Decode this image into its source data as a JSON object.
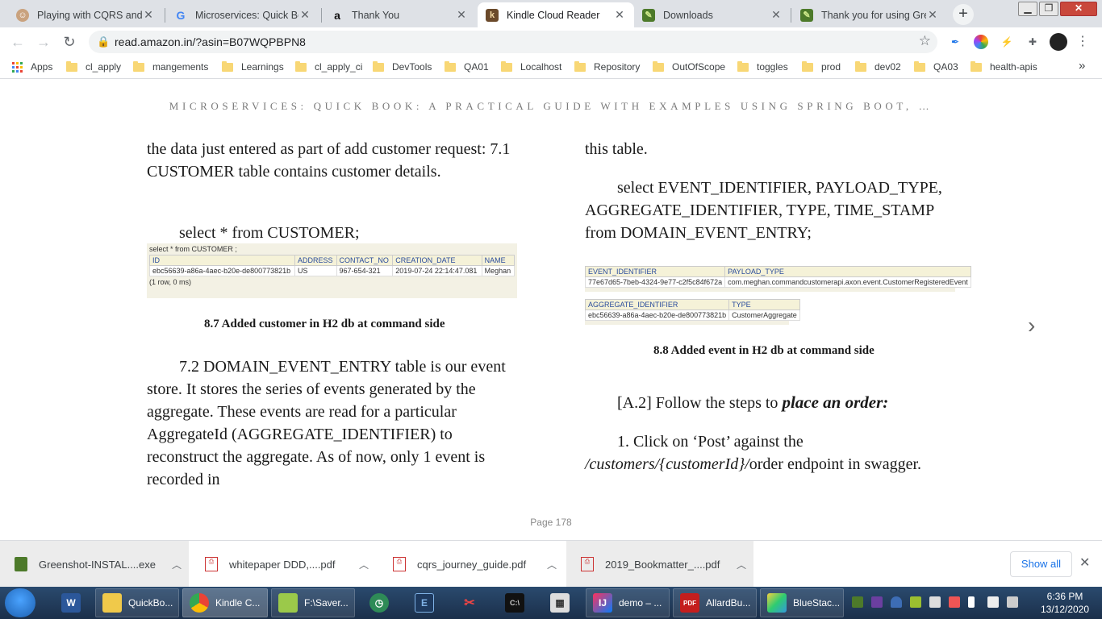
{
  "tabs": [
    {
      "title": "Playing with CQRS and E",
      "favicon": "avatar-icon"
    },
    {
      "title": "Microservices: Quick Boo",
      "favicon": "google-icon"
    },
    {
      "title": "Thank You",
      "favicon": "amazon-icon"
    },
    {
      "title": "Kindle Cloud Reader",
      "favicon": "kindle-icon",
      "active": true
    },
    {
      "title": "Downloads",
      "favicon": "greenshot-icon"
    },
    {
      "title": "Thank you for using Gree",
      "favicon": "greenshot-icon"
    }
  ],
  "toolbar": {
    "url": "read.amazon.in/?asin=B07WQPBPN8"
  },
  "bookmarks": {
    "apps_label": "Apps",
    "items": [
      "cl_apply",
      "mangements",
      "Learnings",
      "cl_apply_ci",
      "DevTools",
      "QA01",
      "Localhost",
      "Repository",
      "OutOfScope",
      "toggles",
      "prod",
      "dev02",
      "QA03",
      "health-apis"
    ],
    "overflow": "»"
  },
  "book": {
    "title": "MICROSERVICES: QUICK BOOK: A PRACTICAL GUIDE WITH EXAMPLES USING SPRING BOOT, …",
    "left": {
      "para1": "the data just entered as part of add customer request: 7.1 CUSTOMER table contains customer details.",
      "query": "select * from CUSTOMER;",
      "shot": {
        "header": "select * from CUSTOMER ;",
        "columns": [
          "ID",
          "ADDRESS",
          "CONTACT_NO",
          "CREATION_DATE",
          "NAME"
        ],
        "row": [
          "ebc56639-a86a-4aec-b20e-de800773821b",
          "US",
          "967-654-321",
          "2019-07-24 22:14:47.081",
          "Meghan"
        ],
        "footer": "(1 row, 0 ms)"
      },
      "caption": "8.7 Added customer in H2 db at command side",
      "para2": "7.2 DOMAIN_EVENT_ENTRY table is our event store. It stores the series of events generated by the aggregate. These events are read for a particular AggregateId (AGGREGATE_IDENTIFIER) to reconstruct the aggregate. As of now, only 1 event is recorded in"
    },
    "right": {
      "para1": "this table.",
      "query": "select EVENT_IDENTIFIER, PAYLOAD_TYPE, AGGREGATE_IDENTIFIER, TYPE,  TIME_STAMP  from DOMAIN_EVENT_ENTRY;",
      "shot1": {
        "columns": [
          "EVENT_IDENTIFIER",
          "PAYLOAD_TYPE"
        ],
        "row": [
          "77e67d65-7beb-4324-9e77-c2f5c84f672a",
          "com.meghan.commandcustomerapi.axon.event.CustomerRegisteredEvent"
        ]
      },
      "shot2": {
        "columns": [
          "AGGREGATE_IDENTIFIER",
          "TYPE"
        ],
        "row": [
          "ebc56639-a86a-4aec-b20e-de800773821b",
          "CustomerAggregate"
        ]
      },
      "caption": "8.8 Added event in H2 db at command side",
      "step_prefix": "[A.2] Follow the steps to ",
      "step_emph": "place an order:",
      "item_prefix": "1. Click on ‘Post’ against the ",
      "item_path": "/customers/{customerId}/",
      "item_suffix": "order endpoint in swagger."
    },
    "page": "Page 178"
  },
  "downloads": {
    "items": [
      "Greenshot-INSTAL....exe",
      "whitepaper DDD,....pdf",
      "cqrs_journey_guide.pdf",
      "2019_Bookmatter_....pdf"
    ],
    "show_all": "Show all"
  },
  "taskbar": {
    "items": [
      {
        "label": "",
        "icon": "word-icon"
      },
      {
        "label": "QuickBo...",
        "icon": "folder-icon"
      },
      {
        "label": "Kindle C...",
        "icon": "chrome-icon"
      },
      {
        "label": "F:\\Saver...",
        "icon": "notepad-icon"
      },
      {
        "label": "",
        "icon": "clock-app-icon"
      },
      {
        "label": "",
        "icon": "editor-icon"
      },
      {
        "label": "",
        "icon": "snipping-icon"
      },
      {
        "label": "",
        "icon": "terminal-icon"
      },
      {
        "label": "",
        "icon": "calculator-icon"
      },
      {
        "label": "demo – ...",
        "icon": "intellij-icon"
      },
      {
        "label": "AllardBu...",
        "icon": "pdf-icon"
      },
      {
        "label": "BlueStac...",
        "icon": "bluestacks-icon"
      }
    ],
    "time": "6:36 PM",
    "date": "13/12/2020"
  }
}
